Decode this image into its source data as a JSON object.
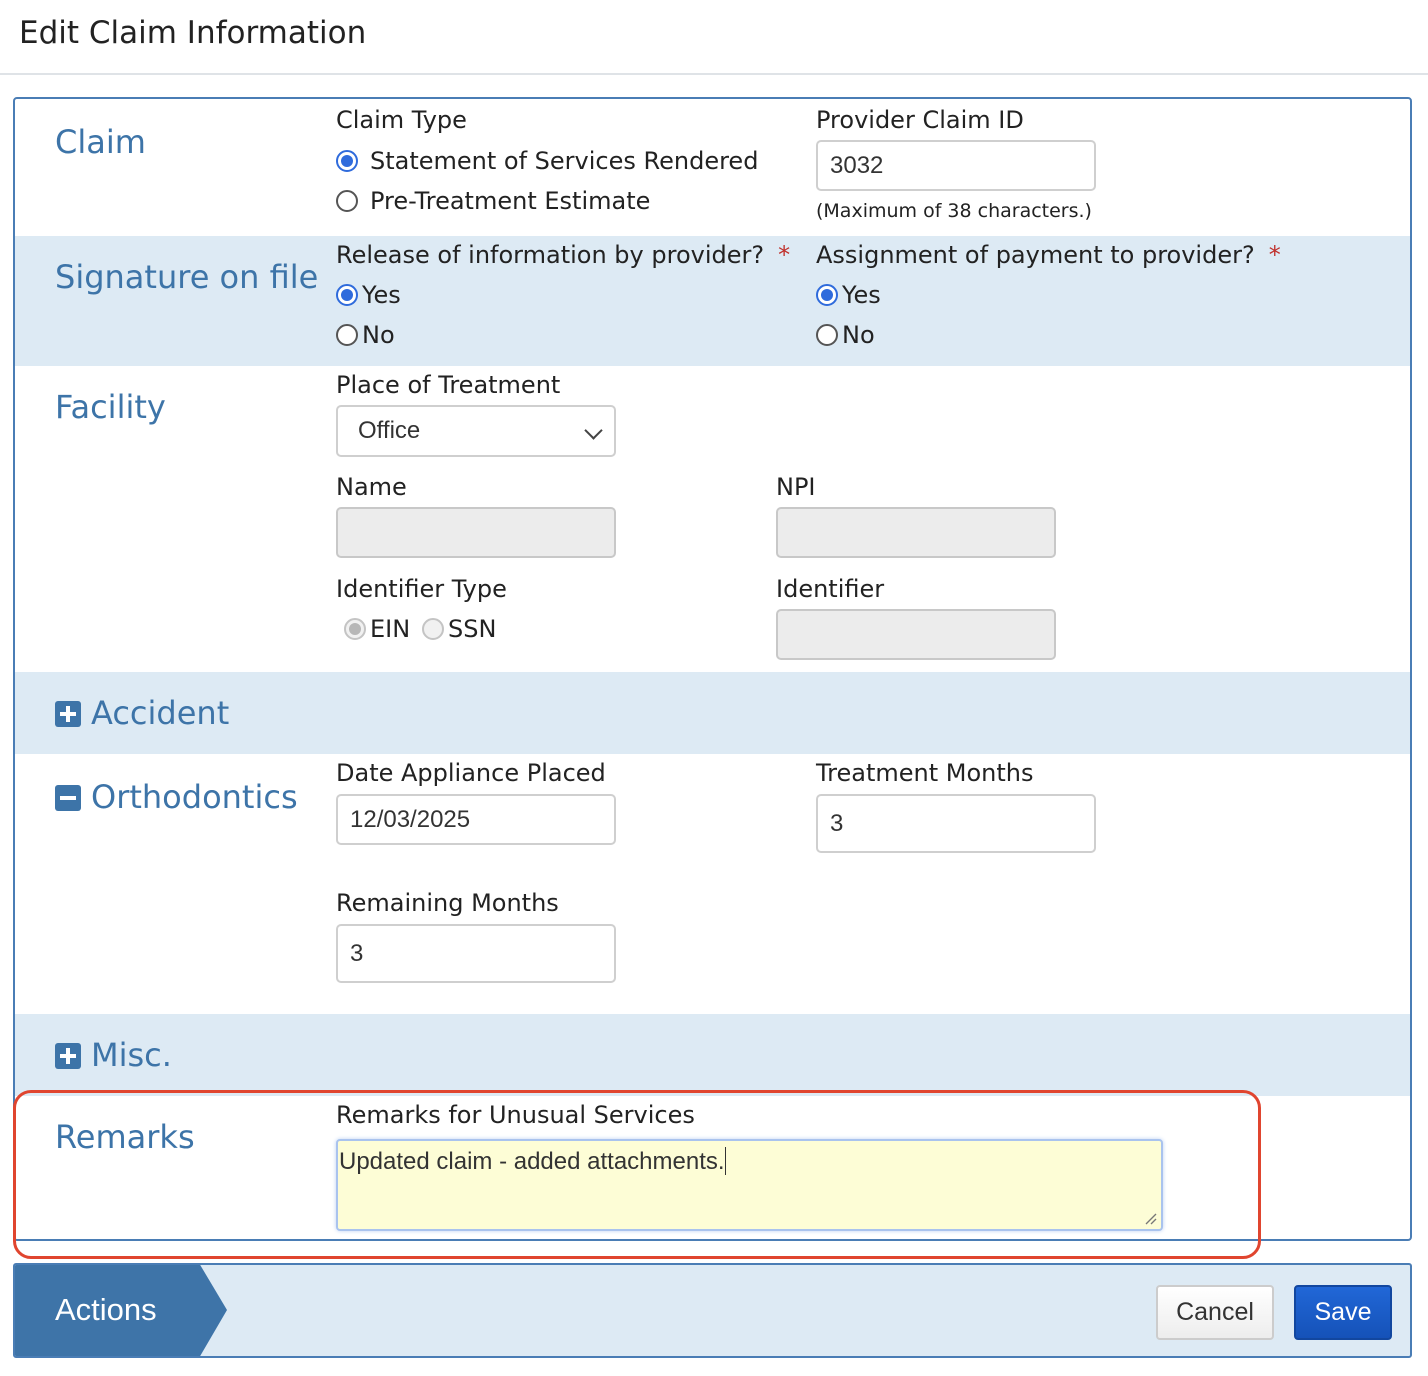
{
  "page": {
    "title": "Edit Claim Information"
  },
  "claim": {
    "section_title": "Claim",
    "claim_type_label": "Claim Type",
    "claim_type_options": [
      "Statement of Services Rendered",
      "Pre-Treatment Estimate"
    ],
    "claim_type_selected": "Statement of Services Rendered",
    "provider_claim_id_label": "Provider Claim ID",
    "provider_claim_id_value": "3032",
    "provider_claim_id_help": "(Maximum of 38 characters.)"
  },
  "signature": {
    "section_title": "Signature on file",
    "release_label": "Release of information by provider?",
    "release_options": [
      "Yes",
      "No"
    ],
    "release_selected": "Yes",
    "assignment_label": "Assignment of payment to provider?",
    "assignment_options": [
      "Yes",
      "No"
    ],
    "assignment_selected": "Yes",
    "required_marker": "*"
  },
  "facility": {
    "section_title": "Facility",
    "place_label": "Place of Treatment",
    "place_value": "Office",
    "name_label": "Name",
    "name_value": "",
    "npi_label": "NPI",
    "npi_value": "",
    "identifier_type_label": "Identifier Type",
    "identifier_type_options": [
      "EIN",
      "SSN"
    ],
    "identifier_type_selected": "EIN",
    "identifier_label": "Identifier",
    "identifier_value": ""
  },
  "accident": {
    "section_title": "Accident",
    "expanded": false
  },
  "orthodontics": {
    "section_title": "Orthodontics",
    "expanded": true,
    "date_label": "Date Appliance Placed",
    "date_value": "12/03/2025",
    "treatment_months_label": "Treatment Months",
    "treatment_months_value": "3",
    "remaining_months_label": "Remaining Months",
    "remaining_months_value": "3"
  },
  "misc": {
    "section_title": "Misc.",
    "expanded": false
  },
  "remarks": {
    "section_title": "Remarks",
    "label": "Remarks for Unusual Services",
    "value": "Updated claim - added attachments."
  },
  "actions": {
    "title": "Actions",
    "cancel_label": "Cancel",
    "save_label": "Save"
  },
  "colors": {
    "accent": "#3d74a8",
    "section_shade": "#ddeaf4",
    "radio_selected": "#2f6bdc",
    "required": "#c0302b",
    "highlight": "#e0452f",
    "save_button": "#1a5cc8",
    "remarks_background": "#fdfdd6"
  }
}
